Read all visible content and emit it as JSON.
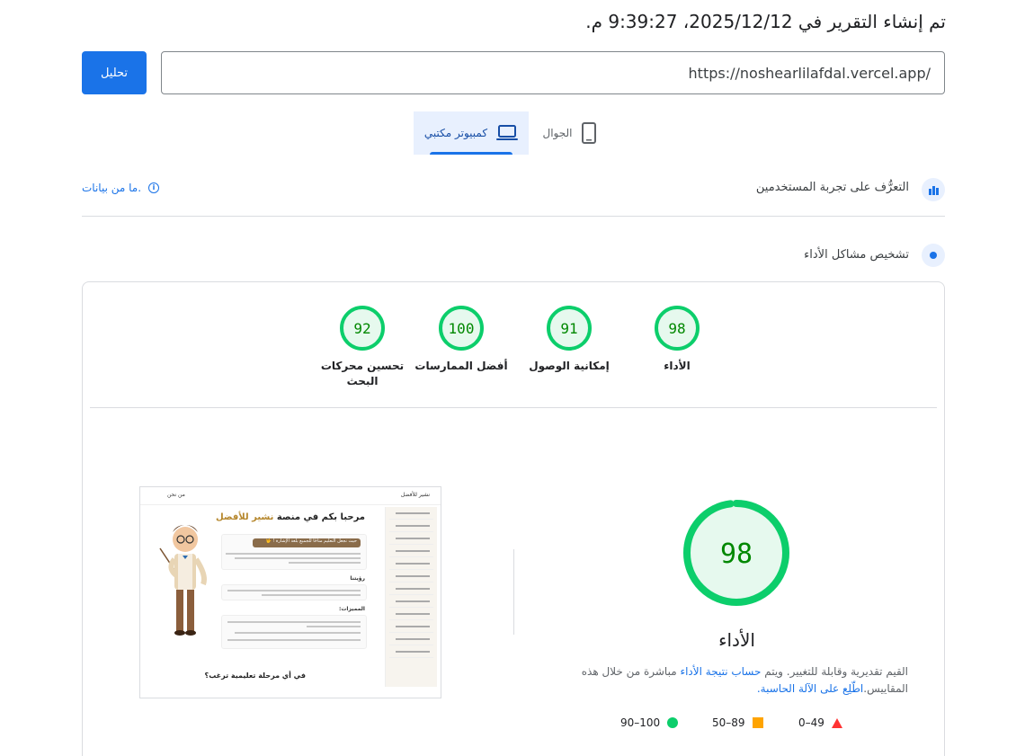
{
  "header": {
    "report_time": "تم إنشاء التقرير في 2025/12/12، 9:39:27 م."
  },
  "url_bar": {
    "url_value": "https://noshearlilafdal.vercel.app/",
    "analyze_label": "تحليل"
  },
  "device_tabs": {
    "mobile_label": "الجوال",
    "desktop_label": "كمبيوتر مكتبي",
    "selected": "desktop"
  },
  "ux_section": {
    "title": "التعرُّف على تجربة المستخدمين",
    "no_data_label": "ما من بيانات."
  },
  "diagnosis": {
    "title": "تشخيص مشاكل الأداء"
  },
  "scores": [
    {
      "value": "98",
      "label": "الأداء"
    },
    {
      "value": "91",
      "label": "إمكانية الوصول"
    },
    {
      "value": "100",
      "label": "أفضل الممارسات"
    },
    {
      "value": "92",
      "label": "تحسين محركات البحث"
    }
  ],
  "colors": {
    "pass": "#0cce6b",
    "average": "#ffa400",
    "fail": "#ff3333",
    "accent": "#1a73e8"
  },
  "performance": {
    "score": "98",
    "score_fraction": 0.98,
    "title": "الأداء",
    "note_1": "القيم تقديرية وقابلة للتغيير. ويتم ",
    "note_link_1": "حساب نتيجة الأداء",
    "note_2": " مباشرة من خلال هذه المقاييس.",
    "note_link_2": "اطّلِع على الآلة الحاسبة."
  },
  "legend": {
    "fail": "0–49",
    "average": "50–89",
    "pass": "90–100"
  },
  "screenshot": {
    "logo_text": "نشير للأفضل",
    "about_text": "من نحن",
    "heading_main": "مرحبا بكم في منصة ",
    "heading_accent": "نشير للأفضل",
    "box_1_title": "حيث نجعل التعليم متاحًا للجميع بلغة الإشارة ! 🤟",
    "vision_label": "رؤيتنا",
    "features_label": "المميزات:",
    "question": "في أي مرحلة تعليمية ترغب؟"
  }
}
